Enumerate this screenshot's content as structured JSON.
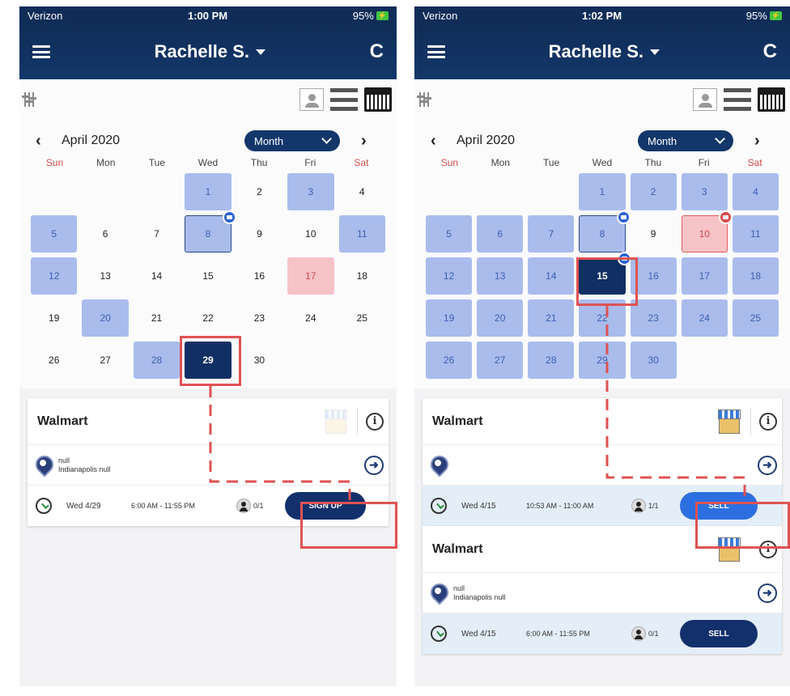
{
  "screens": [
    {
      "status": {
        "carrier": "Verizon",
        "time": "1:00 PM",
        "battery": "95%"
      },
      "app": {
        "title": "Rachelle S."
      },
      "calendar": {
        "month_label": "April 2020",
        "view_selector": "Month",
        "weekdays": [
          "Sun",
          "Mon",
          "Tue",
          "Wed",
          "Thu",
          "Fri",
          "Sat"
        ],
        "days": [
          {
            "d": "",
            "s": ""
          },
          {
            "d": "",
            "s": ""
          },
          {
            "d": "",
            "s": ""
          },
          {
            "d": "1",
            "s": "av"
          },
          {
            "d": "2",
            "s": ""
          },
          {
            "d": "3",
            "s": "av"
          },
          {
            "d": "4",
            "s": ""
          },
          {
            "d": "5",
            "s": "av"
          },
          {
            "d": "6",
            "s": ""
          },
          {
            "d": "7",
            "s": ""
          },
          {
            "d": "8",
            "s": "av out",
            "badge": "blue"
          },
          {
            "d": "9",
            "s": ""
          },
          {
            "d": "10",
            "s": ""
          },
          {
            "d": "11",
            "s": "av"
          },
          {
            "d": "12",
            "s": "av"
          },
          {
            "d": "13",
            "s": ""
          },
          {
            "d": "14",
            "s": ""
          },
          {
            "d": "15",
            "s": ""
          },
          {
            "d": "16",
            "s": ""
          },
          {
            "d": "17",
            "s": "red"
          },
          {
            "d": "18",
            "s": ""
          },
          {
            "d": "19",
            "s": ""
          },
          {
            "d": "20",
            "s": "av"
          },
          {
            "d": "21",
            "s": ""
          },
          {
            "d": "22",
            "s": ""
          },
          {
            "d": "23",
            "s": ""
          },
          {
            "d": "24",
            "s": ""
          },
          {
            "d": "25",
            "s": ""
          },
          {
            "d": "26",
            "s": ""
          },
          {
            "d": "27",
            "s": ""
          },
          {
            "d": "28",
            "s": "av"
          },
          {
            "d": "29",
            "s": "sel"
          },
          {
            "d": "30",
            "s": ""
          }
        ]
      },
      "cards": [
        {
          "store": "Walmart",
          "address_line1": "null",
          "address_line2": "Indianapolis null",
          "shift_day": "Wed 4/29",
          "shift_time": "6:00 AM - 11:55 PM",
          "staff_count": "0/1",
          "action": "SIGN UP"
        }
      ]
    },
    {
      "status": {
        "carrier": "Verizon",
        "time": "1:02 PM",
        "battery": "95%"
      },
      "app": {
        "title": "Rachelle S."
      },
      "calendar": {
        "month_label": "April 2020",
        "view_selector": "Month",
        "weekdays": [
          "Sun",
          "Mon",
          "Tue",
          "Wed",
          "Thu",
          "Fri",
          "Sat"
        ],
        "days": [
          {
            "d": "",
            "s": ""
          },
          {
            "d": "",
            "s": ""
          },
          {
            "d": "",
            "s": ""
          },
          {
            "d": "1",
            "s": "av"
          },
          {
            "d": "2",
            "s": "av"
          },
          {
            "d": "3",
            "s": "av"
          },
          {
            "d": "4",
            "s": "av"
          },
          {
            "d": "5",
            "s": "av"
          },
          {
            "d": "6",
            "s": "av"
          },
          {
            "d": "7",
            "s": "av"
          },
          {
            "d": "8",
            "s": "av out",
            "badge": "blue"
          },
          {
            "d": "9",
            "s": ""
          },
          {
            "d": "10",
            "s": "redo",
            "badge": "red"
          },
          {
            "d": "11",
            "s": "av"
          },
          {
            "d": "12",
            "s": "av"
          },
          {
            "d": "13",
            "s": "av"
          },
          {
            "d": "14",
            "s": "av"
          },
          {
            "d": "15",
            "s": "sel",
            "badge": "blue"
          },
          {
            "d": "16",
            "s": "av"
          },
          {
            "d": "17",
            "s": "av"
          },
          {
            "d": "18",
            "s": "av"
          },
          {
            "d": "19",
            "s": "av"
          },
          {
            "d": "20",
            "s": "av"
          },
          {
            "d": "21",
            "s": "av"
          },
          {
            "d": "22",
            "s": "av"
          },
          {
            "d": "23",
            "s": "av"
          },
          {
            "d": "24",
            "s": "av"
          },
          {
            "d": "25",
            "s": "av"
          },
          {
            "d": "26",
            "s": "av"
          },
          {
            "d": "27",
            "s": "av"
          },
          {
            "d": "28",
            "s": "av"
          },
          {
            "d": "29",
            "s": "av"
          },
          {
            "d": "30",
            "s": "av"
          }
        ]
      },
      "cards": [
        {
          "store": "Walmart",
          "address_line1": "",
          "address_line2": "",
          "shift_day": "Wed 4/15",
          "shift_time": "10:53 AM - 11:00 AM",
          "staff_count": "1/1",
          "action": "SELL"
        },
        {
          "store": "Walmart",
          "address_line1": "null",
          "address_line2": "Indianapolis null",
          "shift_day": "Wed 4/15",
          "shift_time": "6:00 AM - 11:55 PM",
          "staff_count": "0/1",
          "action": "SELL"
        }
      ]
    }
  ],
  "colors": {
    "header": "#0f2d57",
    "available_day": "#a9bcec",
    "selected_day": "#102f63",
    "unavailable_day": "#f6c3c7",
    "highlight": "#e05252"
  }
}
